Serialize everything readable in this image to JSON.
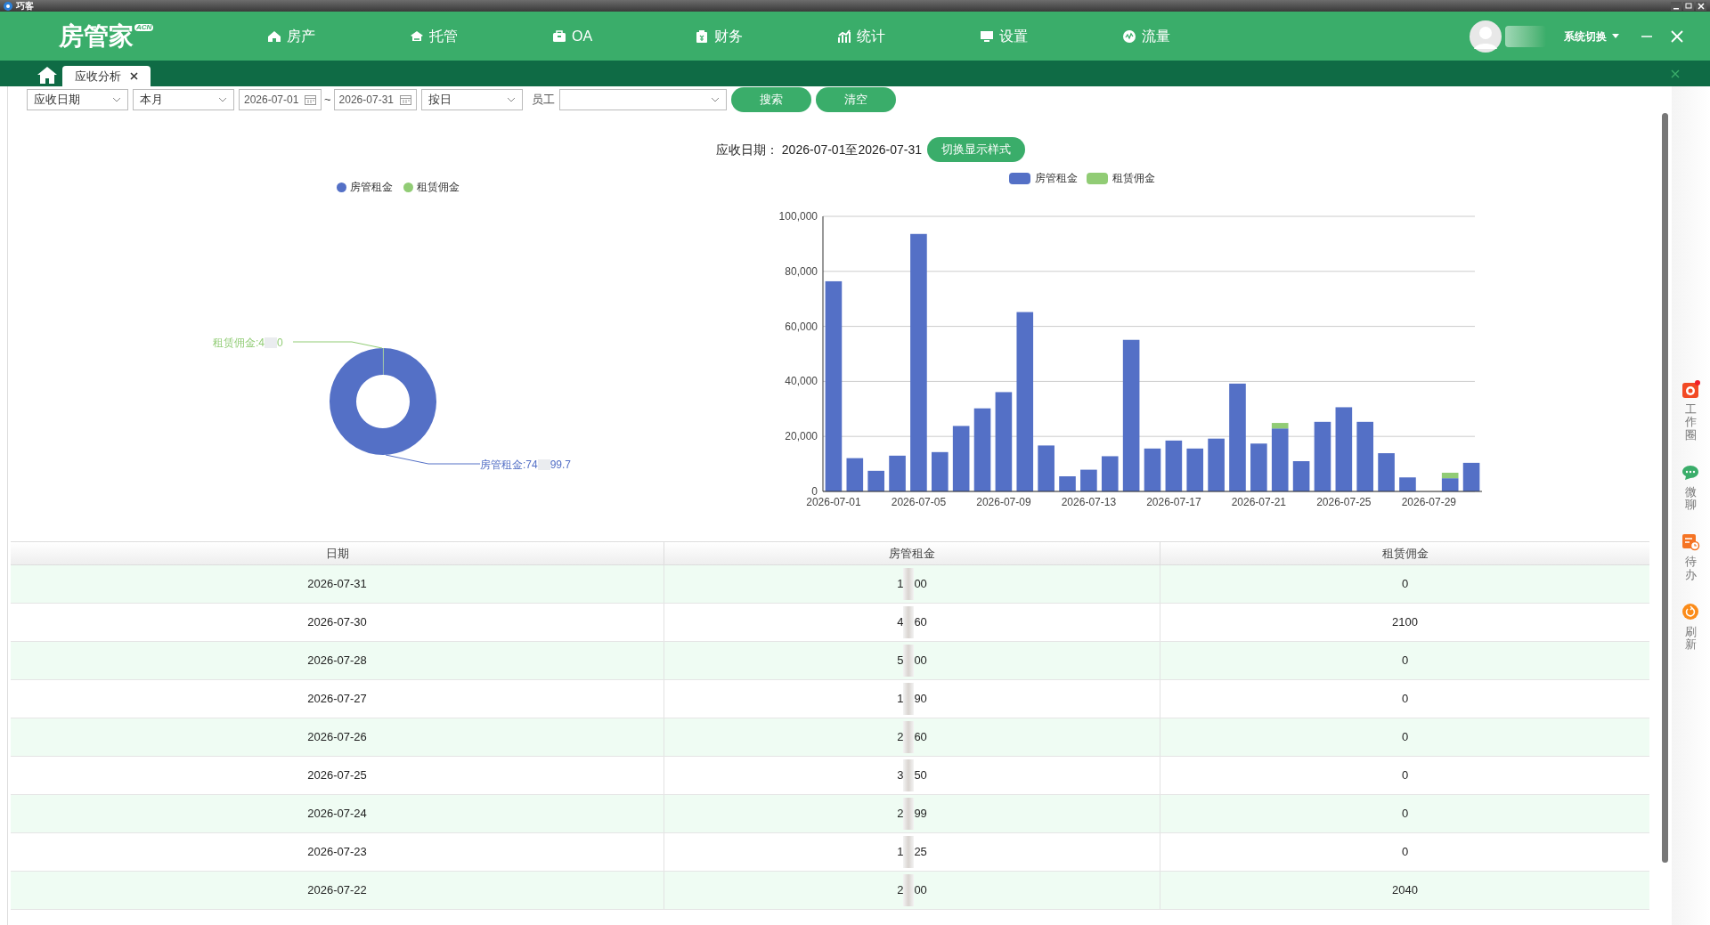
{
  "window": {
    "title": "巧客"
  },
  "header": {
    "logo": "房管家",
    "logo_badge": "ACN",
    "nav": [
      "房产",
      "托管",
      "OA",
      "财务",
      "统计",
      "设置",
      "流量"
    ],
    "system_switch": "系统切换"
  },
  "tabs": [
    {
      "label": "应收分析",
      "selected": true
    }
  ],
  "filters": {
    "date_type": "应收日期",
    "period": "本月",
    "start_date": "2026-07-01",
    "range_sep": "~",
    "end_date": "2026-07-31",
    "group_by": "按日",
    "employee_label": "员工",
    "buttons": [
      "搜索",
      "清空"
    ]
  },
  "summary": {
    "label": "应收日期：",
    "range": "2026-07-01至2026-07-31",
    "toggle_button": "切换显示样式"
  },
  "pie": {
    "legend": [
      {
        "name": "房管租金",
        "color": "#5470c6"
      },
      {
        "name": "租赁佣金",
        "color": "#91cc75"
      }
    ],
    "labels": [
      {
        "start": "租赁佣金:4",
        "end": "0",
        "color": "#91cc75"
      },
      {
        "start": "房管租金:74",
        "end": "99.7",
        "color": "#5470c6"
      }
    ]
  },
  "chart_data": {
    "type": "bar",
    "stacked": true,
    "grid": true,
    "legend": "top",
    "categories": [
      "2026-07-01",
      null,
      null,
      null,
      "2026-07-05",
      null,
      null,
      null,
      "2026-07-09",
      null,
      null,
      null,
      "2026-07-13",
      null,
      null,
      null,
      "2026-07-17",
      null,
      null,
      null,
      "2026-07-21",
      null,
      null,
      null,
      "2026-07-25",
      null,
      null,
      null,
      "2026-07-29",
      null,
      null
    ],
    "series": [
      {
        "name": "房管租金",
        "color": "#5470c6",
        "values": [
          76400,
          12100,
          7500,
          13000,
          93600,
          14300,
          23800,
          30200,
          36100,
          65200,
          16700,
          5500,
          7900,
          12800,
          55100,
          15600,
          18500,
          15600,
          19200,
          39200,
          17400,
          22900,
          11000,
          25300,
          30600,
          25300,
          13900,
          5100,
          0,
          4800,
          10400
        ]
      },
      {
        "name": "租赁佣金",
        "color": "#91cc75",
        "values": [
          0,
          0,
          0,
          0,
          0,
          0,
          0,
          0,
          0,
          0,
          0,
          0,
          0,
          0,
          0,
          0,
          0,
          0,
          0,
          0,
          0,
          2000,
          0,
          0,
          0,
          0,
          0,
          0,
          0,
          2000,
          0
        ]
      }
    ],
    "ylim": [
      0,
      100000
    ],
    "yticks": [
      {
        "value": 0,
        "label": "0"
      },
      {
        "value": 20000,
        "label": "20,000"
      },
      {
        "value": 40000,
        "label": "40,000"
      },
      {
        "value": 60000,
        "label": "60,000"
      },
      {
        "value": 80000,
        "label": "80,000"
      },
      {
        "value": 100000,
        "label": "100,000"
      }
    ]
  },
  "table": {
    "columns": [
      "日期",
      "房管租金",
      "租赁佣金"
    ],
    "rows": [
      {
        "date": "2026-07-31",
        "rent_start": "1",
        "rent_end": "00",
        "commission": "0"
      },
      {
        "date": "2026-07-30",
        "rent_start": "4",
        "rent_end": "60",
        "commission": "2100"
      },
      {
        "date": "2026-07-28",
        "rent_start": "5",
        "rent_end": "00",
        "commission": "0"
      },
      {
        "date": "2026-07-27",
        "rent_start": "1",
        "rent_end": "90",
        "commission": "0"
      },
      {
        "date": "2026-07-26",
        "rent_start": "2",
        "rent_end": "60",
        "commission": "0"
      },
      {
        "date": "2026-07-25",
        "rent_start": "3",
        "rent_end": "50",
        "commission": "0"
      },
      {
        "date": "2026-07-24",
        "rent_start": "2",
        "rent_end": "99",
        "commission": "0"
      },
      {
        "date": "2026-07-23",
        "rent_start": "1",
        "rent_end": "25",
        "commission": "0"
      },
      {
        "date": "2026-07-22",
        "rent_start": "2",
        "rent_end": "00",
        "commission": "2040"
      }
    ]
  },
  "side_tools": [
    {
      "label": "工作圈",
      "badge": true
    },
    {
      "label": "微聊",
      "badge": false
    },
    {
      "label": "待办",
      "badge": false
    },
    {
      "label": "刷新",
      "badge": false
    }
  ]
}
